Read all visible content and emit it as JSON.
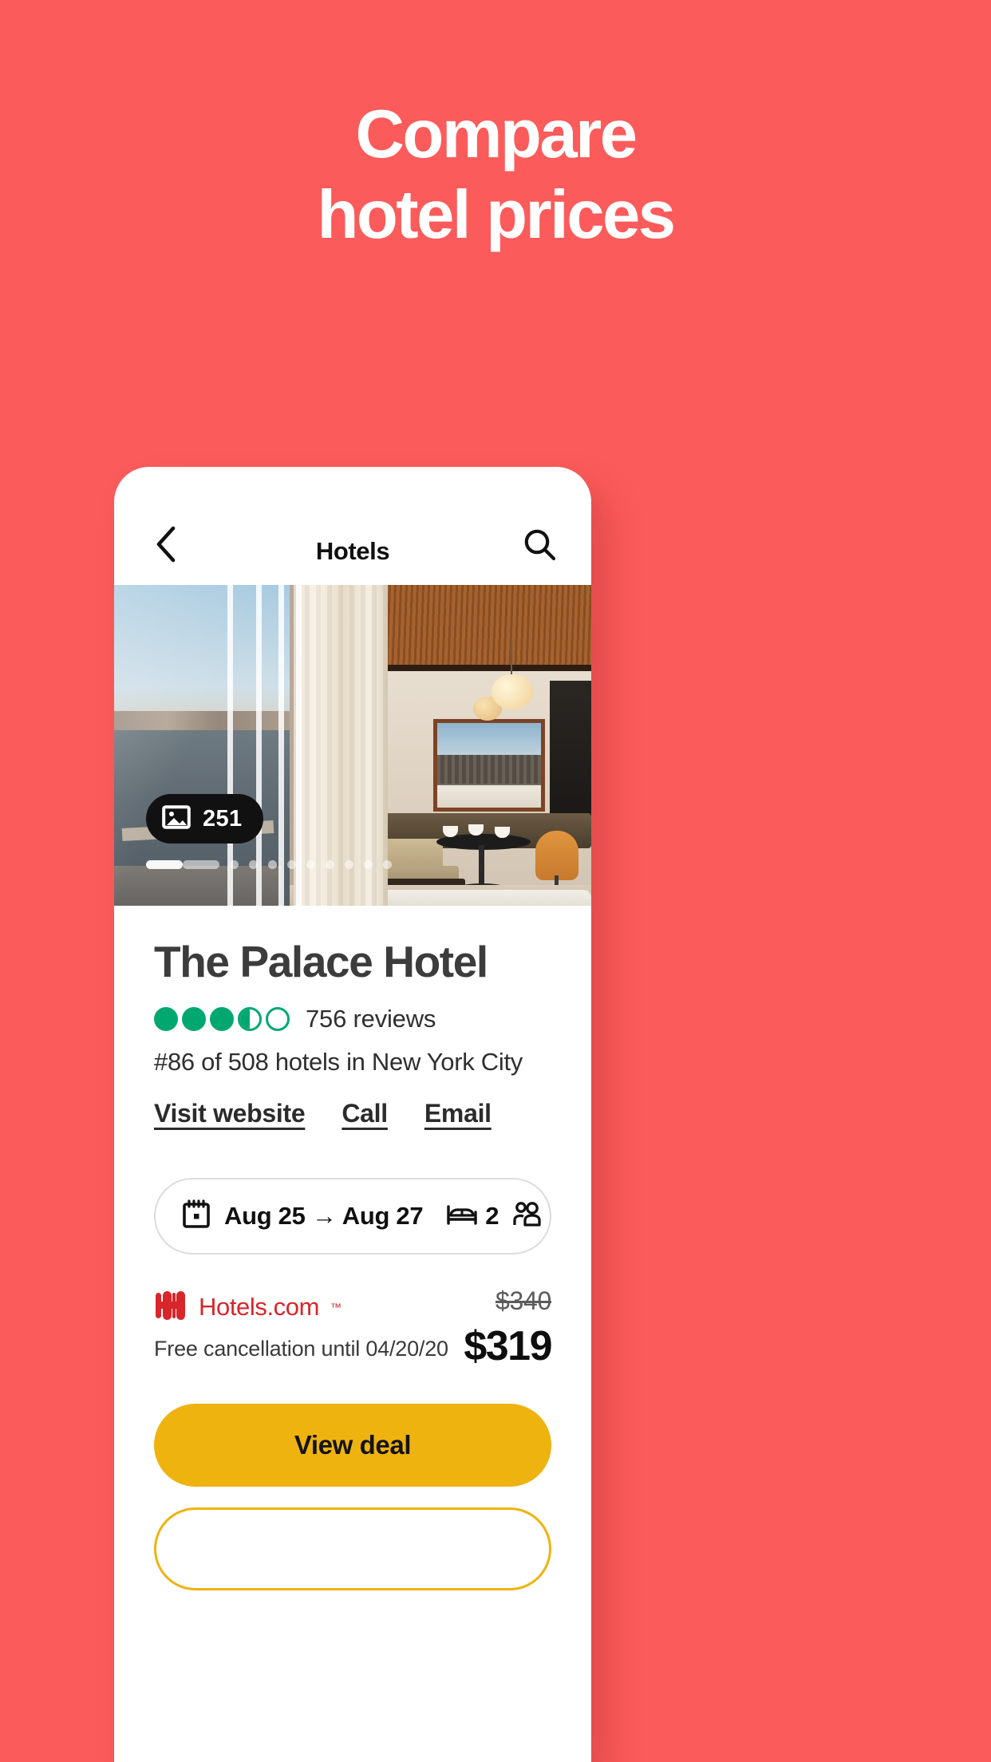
{
  "promo": {
    "headline_line1": "Compare",
    "headline_line2": "hotel prices",
    "background_color": "#fc5b5b"
  },
  "app": {
    "appbar": {
      "title": "Hotels",
      "back_icon": "chevron-left-icon",
      "search_icon": "search-icon"
    },
    "hero": {
      "photo_count": "251",
      "photo_icon": "image-icon",
      "total_dots": 11,
      "active_dot_index": 0
    },
    "hotel": {
      "name": "The Palace Hotel",
      "rating_bubbles_total": 5,
      "rating_bubbles_full": 3,
      "rating_has_half": true,
      "rating_value": "3.5",
      "rating_color": "#00a870",
      "reviews_text": "756 reviews",
      "rank_text": "#86 of 508 hotels in New York City"
    },
    "actions": [
      {
        "label": "Visit website",
        "name": "visit-website-link"
      },
      {
        "label": "Call",
        "name": "call-link"
      },
      {
        "label": "Email",
        "name": "email-link"
      }
    ],
    "search_pill": {
      "calendar_icon": "calendar-icon",
      "dates_label": "Aug 25 → Aug 27",
      "check_in": "Aug 25",
      "check_out": "Aug 27",
      "bed_icon": "bed-icon",
      "rooms": "2",
      "guests_icon": "people-icon",
      "guests": "2"
    },
    "deal": {
      "provider_name": "Hotels.com",
      "provider_tm": "™",
      "provider_color": "#d8262b",
      "cancellation_text": "Free cancellation until 04/20/20",
      "price_old": "$340",
      "price_new": "$319"
    },
    "cta": {
      "primary_label": "View deal",
      "primary_color": "#efb310",
      "secondary_label": ""
    }
  }
}
